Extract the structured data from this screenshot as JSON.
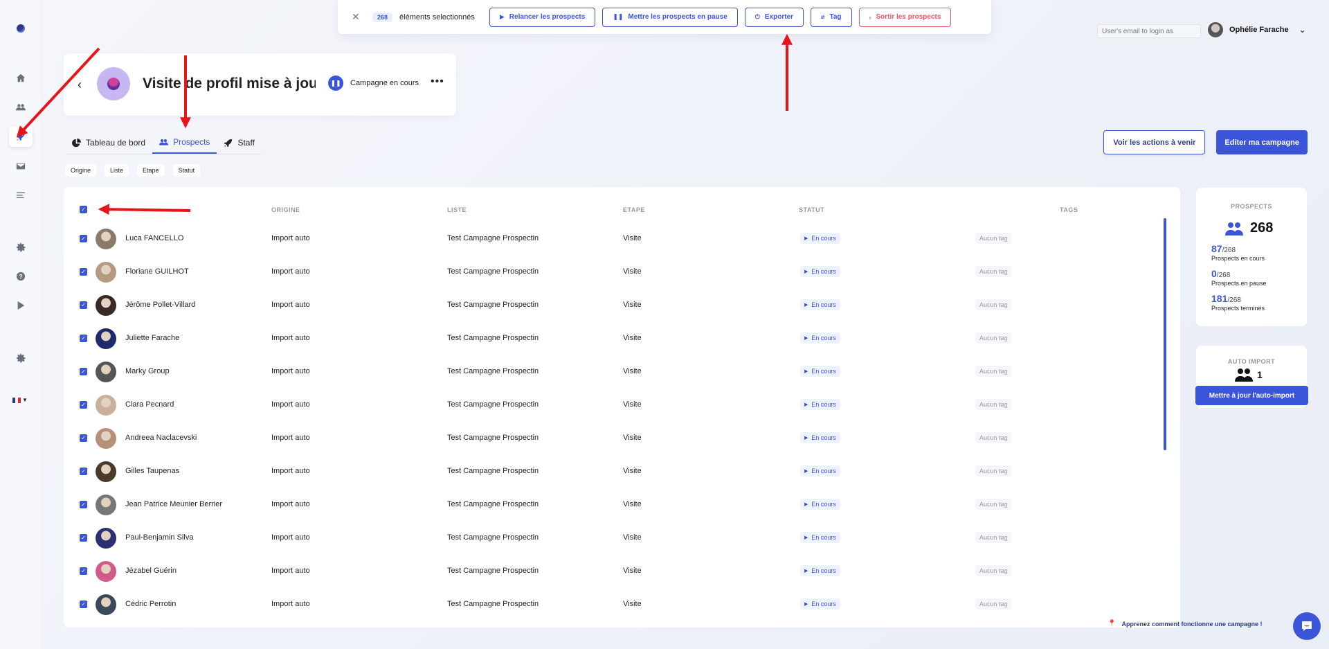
{
  "actionbar": {
    "count": "268",
    "selected_text": "éléments selectionnés",
    "buttons": [
      {
        "label": "Relancer les prospects",
        "icon": "play-icon",
        "glyph": "▶"
      },
      {
        "label": "Mettre les prospects en pause",
        "icon": "pause-icon",
        "glyph": "❚❚"
      },
      {
        "label": "Exporter",
        "icon": "export-icon",
        "glyph": "⏻"
      },
      {
        "label": "Tag",
        "icon": "tag-icon",
        "glyph": "⌀"
      },
      {
        "label": "Sortir les prospects",
        "icon": "exit-icon",
        "glyph": "›"
      }
    ]
  },
  "topright": {
    "login_placeholder": "User's email to login as",
    "user_name": "Ophélie Farache"
  },
  "campaign": {
    "title": "Visite de profil mise à jour",
    "status": "Campagne en cours"
  },
  "tabs": [
    {
      "label": "Tableau de bord",
      "icon": "pie-chart-icon",
      "active": false
    },
    {
      "label": "Prospects",
      "icon": "users-icon",
      "active": true
    },
    {
      "label": "Staff",
      "icon": "rocket-icon",
      "active": false
    }
  ],
  "actions": {
    "upcoming_label": "Voir les actions à venir",
    "edit_label": "Editer ma campagne"
  },
  "filters": [
    "Origine",
    "Liste",
    "Etape",
    "Statut"
  ],
  "table": {
    "columns": [
      "ORIGINE",
      "LISTE",
      "ETAPE",
      "STATUT",
      "TAGS"
    ],
    "rows": [
      {
        "name": "Luca FANCELLO",
        "origin": "Import auto",
        "list": "Test Campagne Prospectin",
        "step": "Visite",
        "status": "En cours",
        "tag": "Aucun tag"
      },
      {
        "name": "Floriane GUILHOT",
        "origin": "Import auto",
        "list": "Test Campagne Prospectin",
        "step": "Visite",
        "status": "En cours",
        "tag": "Aucun tag"
      },
      {
        "name": "Jérôme Pollet-Villard",
        "origin": "Import auto",
        "list": "Test Campagne Prospectin",
        "step": "Visite",
        "status": "En cours",
        "tag": "Aucun tag"
      },
      {
        "name": "Juliette Farache",
        "origin": "Import auto",
        "list": "Test Campagne Prospectin",
        "step": "Visite",
        "status": "En cours",
        "tag": "Aucun tag"
      },
      {
        "name": "Marky Group",
        "origin": "Import auto",
        "list": "Test Campagne Prospectin",
        "step": "Visite",
        "status": "En cours",
        "tag": "Aucun tag"
      },
      {
        "name": "Clara Pecnard",
        "origin": "Import auto",
        "list": "Test Campagne Prospectin",
        "step": "Visite",
        "status": "En cours",
        "tag": "Aucun tag"
      },
      {
        "name": "Andreea Naclacevski",
        "origin": "Import auto",
        "list": "Test Campagne Prospectin",
        "step": "Visite",
        "status": "En cours",
        "tag": "Aucun tag"
      },
      {
        "name": "Gilles Taupenas",
        "origin": "Import auto",
        "list": "Test Campagne Prospectin",
        "step": "Visite",
        "status": "En cours",
        "tag": "Aucun tag"
      },
      {
        "name": "Jean Patrice Meunier Berrier",
        "origin": "Import auto",
        "list": "Test Campagne Prospectin",
        "step": "Visite",
        "status": "En cours",
        "tag": "Aucun tag"
      },
      {
        "name": "Paul-Benjamin Silva",
        "origin": "Import auto",
        "list": "Test Campagne Prospectin",
        "step": "Visite",
        "status": "En cours",
        "tag": "Aucun tag"
      },
      {
        "name": "Jézabel Guérin",
        "origin": "Import auto",
        "list": "Test Campagne Prospectin",
        "step": "Visite",
        "status": "En cours",
        "tag": "Aucun tag"
      },
      {
        "name": "Cédric Perrotin",
        "origin": "Import auto",
        "list": "Test Campagne Prospectin",
        "step": "Visite",
        "status": "En cours",
        "tag": "Aucun tag"
      }
    ]
  },
  "stats": {
    "title": "PROSPECTS",
    "total": "268",
    "items": [
      {
        "num": "87",
        "den": "/268",
        "label": "Prospects en cours"
      },
      {
        "num": "0",
        "den": "/268",
        "label": "Prospects en pause"
      },
      {
        "num": "181",
        "den": "/268",
        "label": "Prospects terminés"
      }
    ]
  },
  "autoimport": {
    "title": "AUTO IMPORT",
    "count": "1",
    "button": "Mettre à jour l'auto-import"
  },
  "footer": {
    "learn": "Apprenez comment fonctionne une campagne !"
  },
  "colors": {
    "accent": "#3a55d8",
    "danger": "#e05a6a",
    "annotation": "#e8141b"
  }
}
